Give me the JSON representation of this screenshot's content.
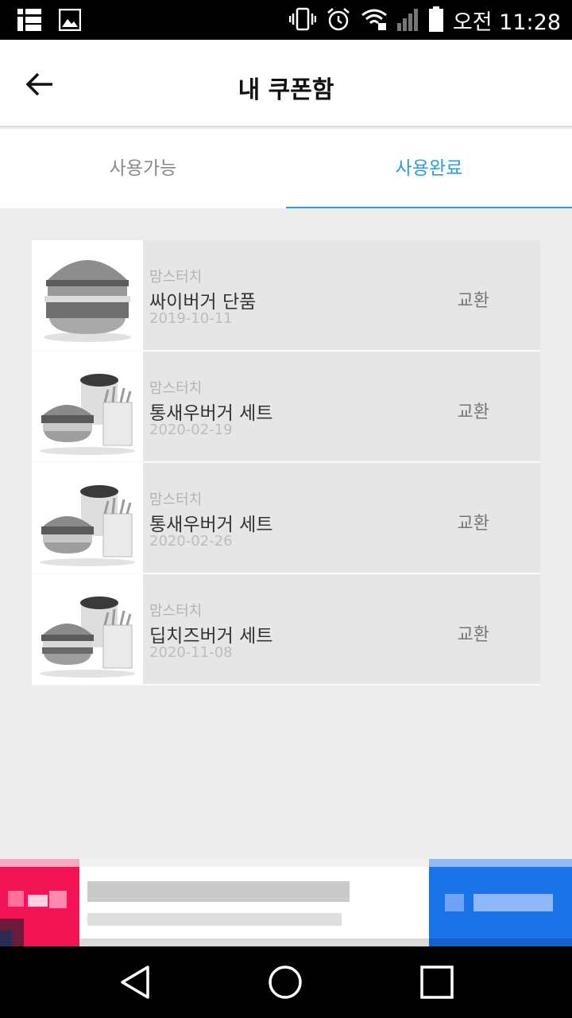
{
  "status_bar": {
    "time": "오전 11:28",
    "icons": [
      "notification-list-icon",
      "gallery-icon",
      "vibrate-icon",
      "alarm-icon",
      "wifi-lock-icon",
      "signal-icon",
      "battery-icon"
    ]
  },
  "header": {
    "title": "내 쿠폰함",
    "back_icon": "back-arrow-icon"
  },
  "tabs": [
    {
      "label": "사용가능",
      "active": false
    },
    {
      "label": "사용완료",
      "active": true
    }
  ],
  "coupons": [
    {
      "brand": "맘스터치",
      "name": "싸이버거 단품",
      "date": "2019-10-11",
      "status": "교환",
      "image": "burger-single"
    },
    {
      "brand": "맘스터치",
      "name": "통새우버거 세트",
      "date": "2020-02-19",
      "status": "교환",
      "image": "burger-set"
    },
    {
      "brand": "맘스터치",
      "name": "통새우버거 세트",
      "date": "2020-02-26",
      "status": "교환",
      "image": "burger-set"
    },
    {
      "brand": "맘스터치",
      "name": "딥치즈버거 세트",
      "date": "2020-11-08",
      "status": "교환",
      "image": "burger-set"
    }
  ],
  "colors": {
    "accent": "#2b9de4",
    "ad_left": "#f21454",
    "ad_right": "#1a74e8"
  },
  "nav_bar": {
    "icons": [
      "back-triangle-icon",
      "home-circle-icon",
      "recents-square-icon"
    ]
  }
}
